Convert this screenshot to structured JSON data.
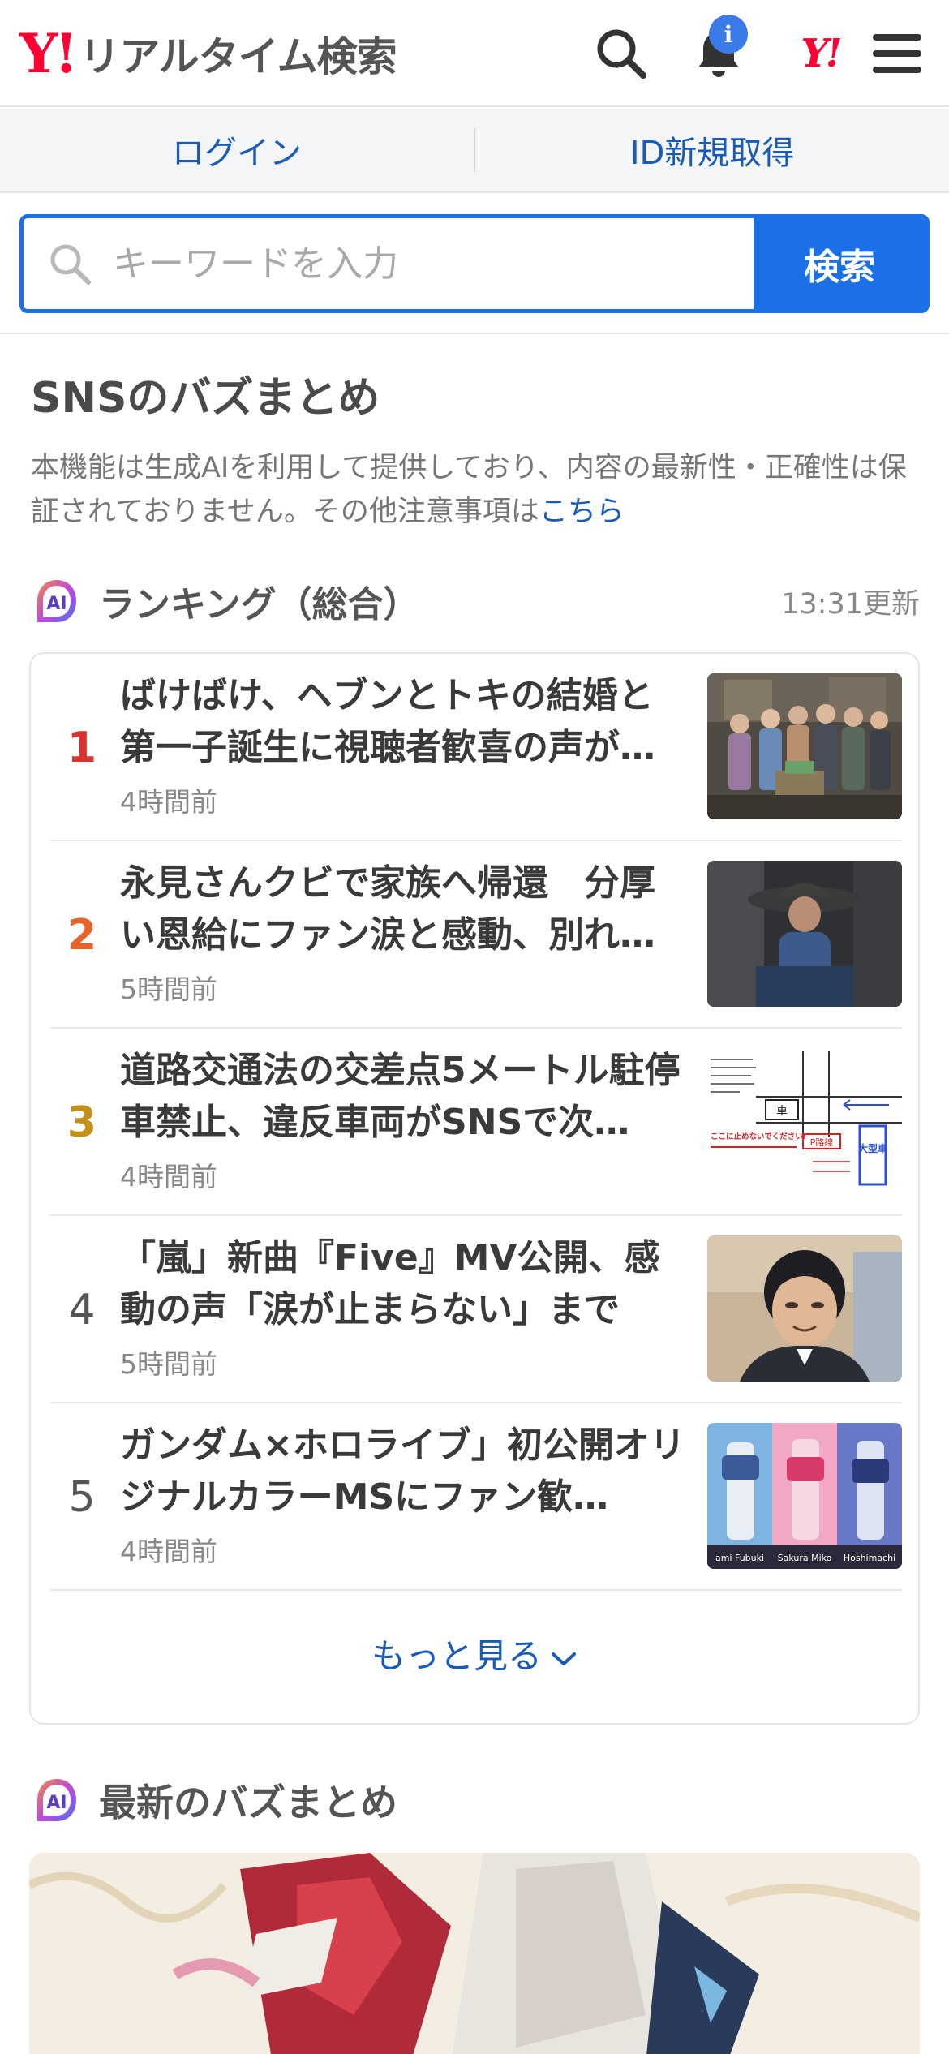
{
  "header": {
    "logo_mark": "Y!",
    "logo_text": "リアルタイム検索",
    "notification_badge": "i",
    "yahoo_mini": "Y!"
  },
  "login_bar": {
    "login_label": "ログイン",
    "register_label": "ID新規取得"
  },
  "search": {
    "placeholder": "キーワードを入力",
    "button_label": "検索"
  },
  "buzz": {
    "title": "SNSのバズまとめ",
    "notice_text": "本機能は生成AIを利用して提供しており、内容の最新性・正確性は保証されておりません。その他注意事項は",
    "notice_link": "こちら"
  },
  "ranking": {
    "ai_badge": "AI",
    "title": "ランキング（総合）",
    "updated": "13:31更新",
    "items": [
      {
        "rank": "1",
        "headline": "ばけばけ、ヘブンとトキの結婚と第一子誕生に視聴者歓喜の声が…",
        "time": "4時間前",
        "color": "#d7322d"
      },
      {
        "rank": "2",
        "headline": "永見さんクビで家族へ帰還　分厚い恩給にファン涙と感動、別れ…",
        "time": "5時間前",
        "color": "#e8632a"
      },
      {
        "rank": "3",
        "headline": "道路交通法の交差点5メートル駐停車禁止、違反車両がSNSで次…",
        "time": "4時間前",
        "color": "#c4901c"
      },
      {
        "rank": "4",
        "headline": "「嵐」新曲『Five』MV公開、感動の声「涙が止まらない」まで",
        "time": "5時間前",
        "color": "#555555"
      },
      {
        "rank": "5",
        "headline": "ガンダム×ホロライブ」初公開オリジナルカラーMSにファン歓…",
        "time": "4時間前",
        "color": "#555555"
      }
    ],
    "thumb3_text": {
      "left_note": "ここに止めないでください!",
      "right_label": "大型車",
      "crossing": "P路線",
      "car": "車"
    },
    "thumb5_captions": [
      "ami Fubuki",
      "Sakura Miko",
      "Hoshimachi"
    ],
    "more_label": "もっと見る"
  },
  "latest": {
    "ai_badge": "AI",
    "title": "最新のバズまとめ"
  },
  "colors": {
    "accent": "#1b70e8",
    "link": "#1a5bb8",
    "brand": "#ff0033"
  }
}
